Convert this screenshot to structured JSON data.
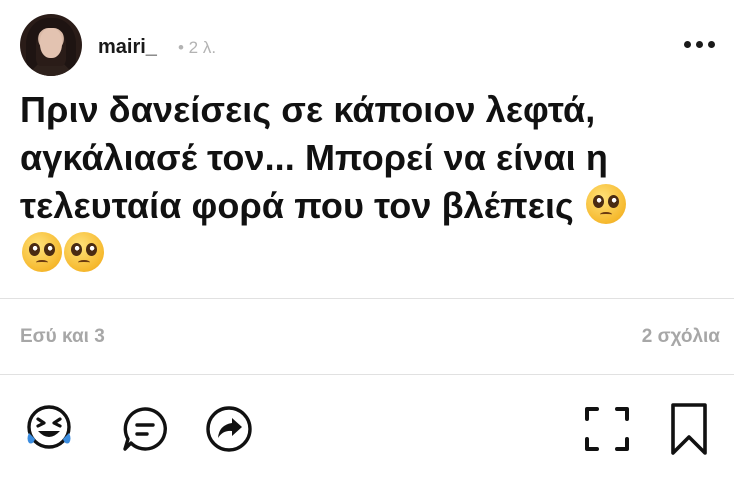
{
  "post": {
    "author": {
      "username": "mairi_"
    },
    "time": "• 2 λ.",
    "text_lines": [
      "Πριν δανείσεις σε κάποιον λεφτά,",
      "αγκάλιασέ τον... Μπορεί να είναι η",
      "τελευταία φορά που τον βλέπεις"
    ],
    "emoji_icon": "pleading-face-emoji",
    "likes_text": "Εσύ και 3",
    "comments_text": "2 σχόλια"
  },
  "actions": {
    "icons": [
      "laughing-reaction-icon",
      "comment-icon",
      "share-icon",
      "expand-icon",
      "bookmark-icon"
    ]
  },
  "colors": {
    "text": "#111111",
    "muted": "#a7a7a7",
    "divider": "#e1e1e1",
    "accent_blue": "#3b8de0"
  }
}
